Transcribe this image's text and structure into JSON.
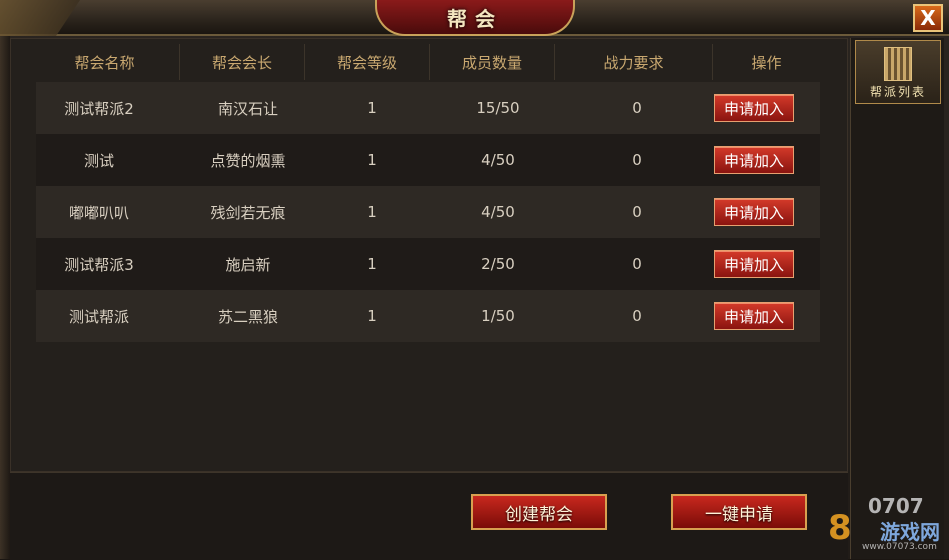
{
  "window": {
    "title": "帮会",
    "close_label": "X"
  },
  "side": {
    "tab_label": "帮派列表"
  },
  "table": {
    "columns": [
      "帮会名称",
      "帮会会长",
      "帮会等级",
      "成员数量",
      "战力要求",
      "操作"
    ],
    "rows": [
      {
        "name": "测试帮派2",
        "leader": "南汉石让",
        "level": "1",
        "members": "15/50",
        "power": "0",
        "action": "申请加入"
      },
      {
        "name": "测试",
        "leader": "点赞的烟熏",
        "level": "1",
        "members": "4/50",
        "power": "0",
        "action": "申请加入"
      },
      {
        "name": "嘟嘟叭叭",
        "leader": "残剑若无痕",
        "level": "1",
        "members": "4/50",
        "power": "0",
        "action": "申请加入"
      },
      {
        "name": "测试帮派3",
        "leader": "施启新",
        "level": "1",
        "members": "2/50",
        "power": "0",
        "action": "申请加入"
      },
      {
        "name": "测试帮派",
        "leader": "苏二黑狼",
        "level": "1",
        "members": "1/50",
        "power": "0",
        "action": "申请加入"
      }
    ]
  },
  "footer": {
    "create_label": "创建帮会",
    "apply_all_label": "一键申请"
  },
  "watermark": {
    "top": "0707",
    "brand": "8",
    "sub": "游戏网",
    "url": "www.07073.com"
  }
}
